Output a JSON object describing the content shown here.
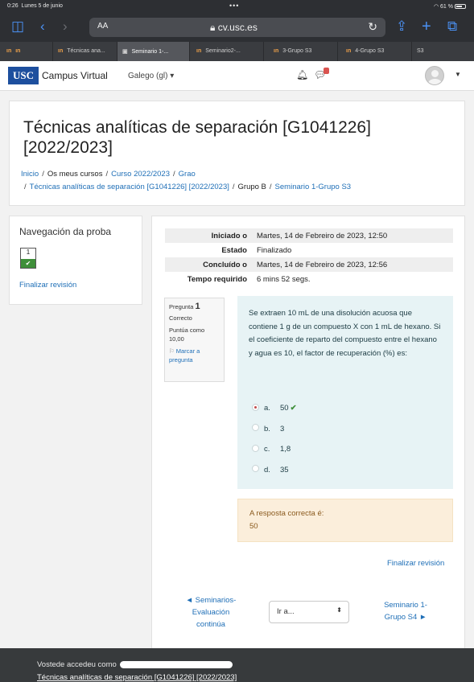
{
  "status_bar": {
    "time": "0:26",
    "date": "Lunes 5 de junio",
    "battery": "61 %"
  },
  "browser": {
    "text_size_label": "AA",
    "url": "cv.usc.es",
    "tabs": [
      {
        "label": "Técnicas ana..."
      },
      {
        "label": "Seminario 1-..."
      },
      {
        "label": "Seminario2-..."
      },
      {
        "label": "3-Grupo S3"
      },
      {
        "label": "4-Grupo S3"
      },
      {
        "label": "S3"
      }
    ]
  },
  "navbar": {
    "logo": "USC",
    "site_name": "Campus Virtual",
    "language": "Galego (gl) ▾"
  },
  "header": {
    "title": "Técnicas analíticas de separación [G1041226] [2022/2023]",
    "breadcrumbs": {
      "home": "Inicio",
      "my_courses": "Os meus cursos",
      "year": "Curso 2022/2023",
      "level": "Grao",
      "course": "Técnicas analíticas de separación [G1041226] [2022/2023]",
      "group": "Grupo B",
      "quiz": "Seminario 1-Grupo S3"
    }
  },
  "quiz_nav": {
    "title": "Navegación da proba",
    "question_number": "1",
    "finish_label": "Finalizar revisión"
  },
  "summary": [
    {
      "label": "Iniciado o",
      "value": "Martes, 14 de Febreiro de 2023, 12:50"
    },
    {
      "label": "Estado",
      "value": "Finalizado"
    },
    {
      "label": "Concluído o",
      "value": "Martes, 14 de Febreiro de 2023, 12:56"
    },
    {
      "label": "Tempo requirido",
      "value": "6 mins 52 segs."
    }
  ],
  "question": {
    "label": "Pregunta",
    "number": "1",
    "state": "Correcto",
    "score": "Puntúa como 10,00",
    "flag_label": "Marcar a pregunta",
    "text": "Se extraen 10 mL de una disolución acuosa que contiene 1 g de un compuesto X con 1 mL de hexano. Si el coeficiente de reparto del compuesto entre el hexano y agua es 10, el factor de recuperación (%) es:",
    "answers": [
      {
        "letter": "a.",
        "value": "50",
        "checked": true,
        "correct": true
      },
      {
        "letter": "b.",
        "value": "3",
        "checked": false,
        "correct": false
      },
      {
        "letter": "c.",
        "value": "1,8",
        "checked": false,
        "correct": false
      },
      {
        "letter": "d.",
        "value": "35",
        "checked": false,
        "correct": false
      }
    ],
    "feedback_label": "A resposta correcta é:",
    "feedback_value": "50"
  },
  "actions": {
    "finish_review": "Finalizar revisión",
    "prev_activity": "◄ Seminarios-Evaluación continúa",
    "jump_to": "Ir a...",
    "next_activity": "Seminario 1-Grupo S4 ►"
  },
  "footer": {
    "logged_in_as": "Vostede accedeu como",
    "course_link": "Técnicas analíticas de separación [G1041226] [2022/2023]"
  },
  "colors": {
    "link": "#1f6fb7",
    "correct": "#3f8f3a",
    "question_bg": "#e7f3f5",
    "feedback_bg": "#fbeedb",
    "footer_bg": "#373a3c"
  }
}
